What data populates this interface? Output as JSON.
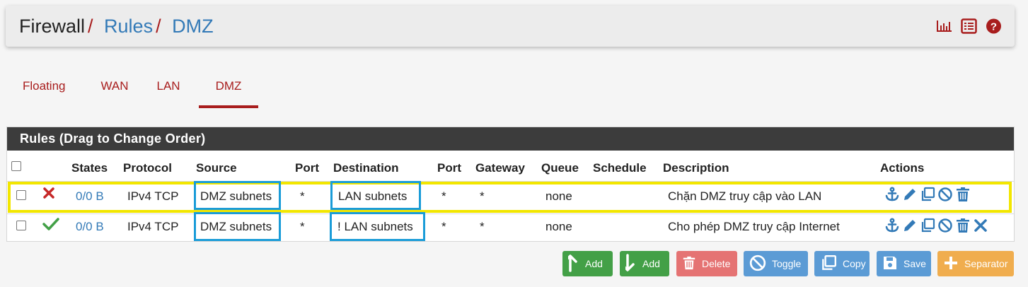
{
  "breadcrumb": {
    "root": "Firewall",
    "sep1": "/",
    "rules": "Rules",
    "sep2": "/",
    "current": "DMZ"
  },
  "header_icons": [
    "chart-icon",
    "list-icon",
    "help-icon"
  ],
  "tabs": [
    {
      "label": "Floating",
      "active": false
    },
    {
      "label": "WAN",
      "active": false
    },
    {
      "label": "LAN",
      "active": false
    },
    {
      "label": "DMZ",
      "active": true
    }
  ],
  "panel": {
    "title": "Rules (Drag to Change Order)",
    "columns": [
      "States",
      "Protocol",
      "Source",
      "Port",
      "Destination",
      "Port",
      "Gateway",
      "Queue",
      "Schedule",
      "Description",
      "Actions"
    ],
    "rows": [
      {
        "status": "block",
        "states": "0/0 B",
        "protocol": "IPv4 TCP",
        "source": "DMZ subnets",
        "port": "*",
        "destination": "LAN subnets",
        "dport": "*",
        "gateway": "*",
        "queue": "none",
        "schedule": "",
        "description": "Chặn DMZ truy cập vào LAN",
        "highlighted": true
      },
      {
        "status": "pass",
        "states": "0/0 B",
        "protocol": "IPv4 TCP",
        "source": "DMZ subnets",
        "port": "*",
        "destination": "! LAN subnets",
        "dport": "*",
        "gateway": "*",
        "queue": "none",
        "schedule": "",
        "description": "Cho phép DMZ truy cập Internet",
        "highlighted": false
      }
    ]
  },
  "buttons": {
    "add_top": "Add",
    "add_bottom": "Add",
    "delete": "Delete",
    "toggle": "Toggle",
    "copy": "Copy",
    "save": "Save",
    "separator": "Separator"
  },
  "colors": {
    "accent_red": "#a81d1d",
    "link_blue": "#337ab7",
    "highlight_yellow": "#f2e600",
    "box_blue": "#1a9cd8"
  }
}
